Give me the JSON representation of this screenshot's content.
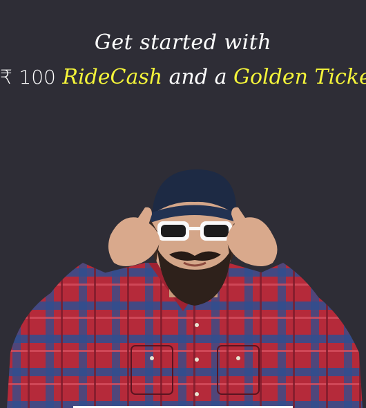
{
  "promo": {
    "line1": "Get started with",
    "currency_symbol": "₹",
    "amount": "100",
    "ridecash": "RideCash",
    "and_a": "and a",
    "golden_ticket": "Golden Ticket",
    "period": "."
  },
  "colors": {
    "background": "#2e2d36",
    "text": "#ffffff",
    "highlight": "#f5f53a"
  },
  "illustration": {
    "subject": "man-with-sunglasses-and-beard"
  }
}
